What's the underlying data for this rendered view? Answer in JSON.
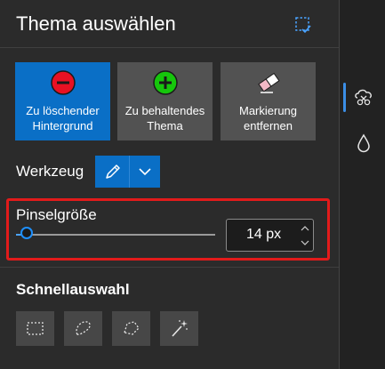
{
  "panel": {
    "title": "Thema auswählen",
    "title_icon": "clipboard-select-icon"
  },
  "tool_buttons": [
    {
      "label": "Zu löschender\nHintergrund",
      "icon": "minus-circle-red-icon",
      "active": true
    },
    {
      "label": "Zu behaltendes\nThema",
      "icon": "plus-circle-green-icon",
      "active": false
    },
    {
      "label": "Markierung\nentfernen",
      "icon": "eraser-icon",
      "active": false
    }
  ],
  "werkzeug": {
    "label": "Werkzeug",
    "selected_tool_icon": "pen-icon"
  },
  "pinsel": {
    "label": "Pinselgröße",
    "value": "14 px",
    "slider_level": 0.06
  },
  "schnellauswahl": {
    "label": "Schnellauswahl",
    "tools": [
      "rectangle-select-icon",
      "lasso-select-icon",
      "polygon-lasso-icon",
      "magic-wand-icon"
    ]
  },
  "rail": {
    "icons": [
      "background-removal-icon",
      "droplet-icon"
    ]
  },
  "colors": {
    "accent": "#0a6fc6",
    "highlight_border": "#e21b1b",
    "minus_icon": "#e81123",
    "plus_icon": "#16c60c"
  }
}
